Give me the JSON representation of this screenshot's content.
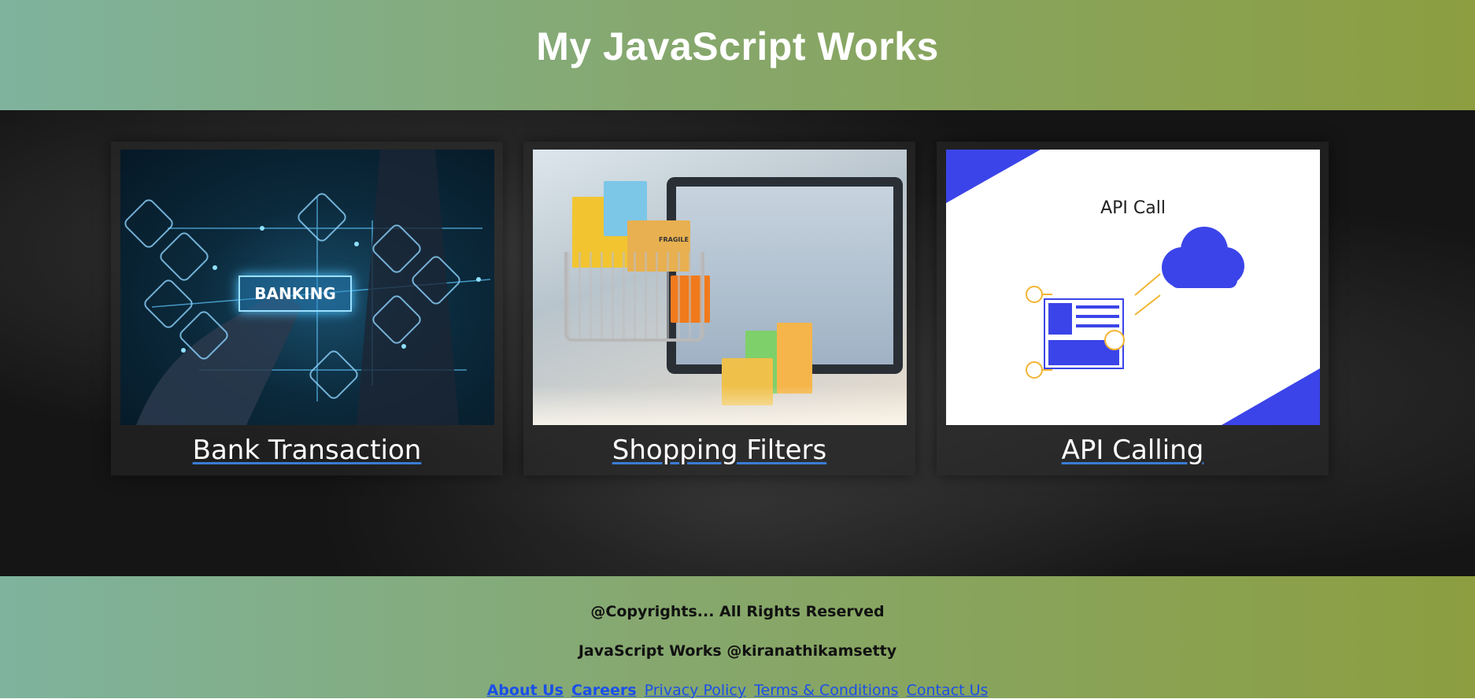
{
  "header": {
    "title": "My JavaScript Works"
  },
  "cards": [
    {
      "title": "Bank Transaction",
      "image_text": "BANKING",
      "icon": "banking-image"
    },
    {
      "title": "Shopping Filters",
      "image_text": "FRAGILE",
      "icon": "shopping-image"
    },
    {
      "title": "API Calling",
      "image_text": "API Call",
      "icon": "api-image"
    }
  ],
  "footer": {
    "copyright": "@Copyrights... All Rights Reserved",
    "credit": "JavaScript Works @kiranathikamsetty",
    "links": [
      "About Us",
      "Careers",
      "Privacy Policy",
      "Terms & Conditions",
      "Contact Us"
    ]
  },
  "colors": {
    "header_gradient_start": "#7fb39e",
    "header_gradient_end": "#8c9e40",
    "link": "#1a4fe8",
    "api_accent": "#3b44e8"
  }
}
